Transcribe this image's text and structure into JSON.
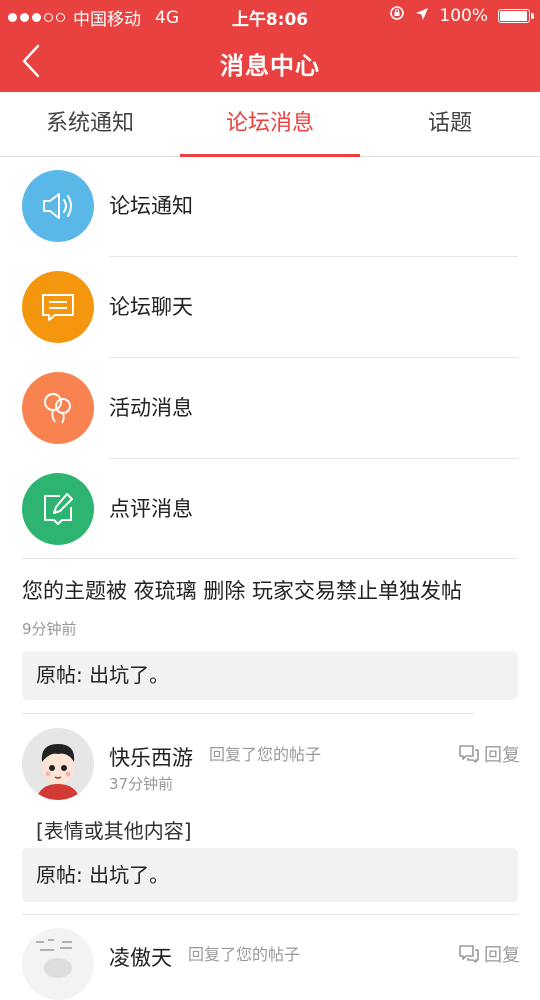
{
  "status_bar": {
    "carrier": "中国移动",
    "network": "4G",
    "time": "上午8:06",
    "battery": "100%"
  },
  "nav": {
    "title": "消息中心",
    "back_icon": "chevron-left-icon"
  },
  "tabs": [
    {
      "label": "系统通知",
      "active": false
    },
    {
      "label": "论坛消息",
      "active": true
    },
    {
      "label": "话题",
      "active": false
    }
  ],
  "categories": [
    {
      "label": "论坛通知",
      "icon": "speaker-icon",
      "color": "#5ab8e8"
    },
    {
      "label": "论坛聊天",
      "icon": "chat-bubble-icon",
      "color": "#f5960f"
    },
    {
      "label": "活动消息",
      "icon": "balloon-icon",
      "color": "#f98350"
    },
    {
      "label": "点评消息",
      "icon": "edit-icon",
      "color": "#2db471"
    }
  ],
  "messages": [
    {
      "text": "您的主题被 夜琉璃 删除 玩家交易禁止单独发帖",
      "time": "9分钟前",
      "quote": "原帖: 出坑了。"
    },
    {
      "user": "快乐西游",
      "action": "回复了您的帖子",
      "time": "37分钟前",
      "content": "[表情或其他内容]",
      "quote": "原帖: 出坑了。",
      "reply_label": "回复"
    },
    {
      "user": "凌傲天",
      "action": "回复了您的帖子",
      "reply_label": "回复"
    }
  ],
  "colors": {
    "accent": "#e9413f"
  }
}
